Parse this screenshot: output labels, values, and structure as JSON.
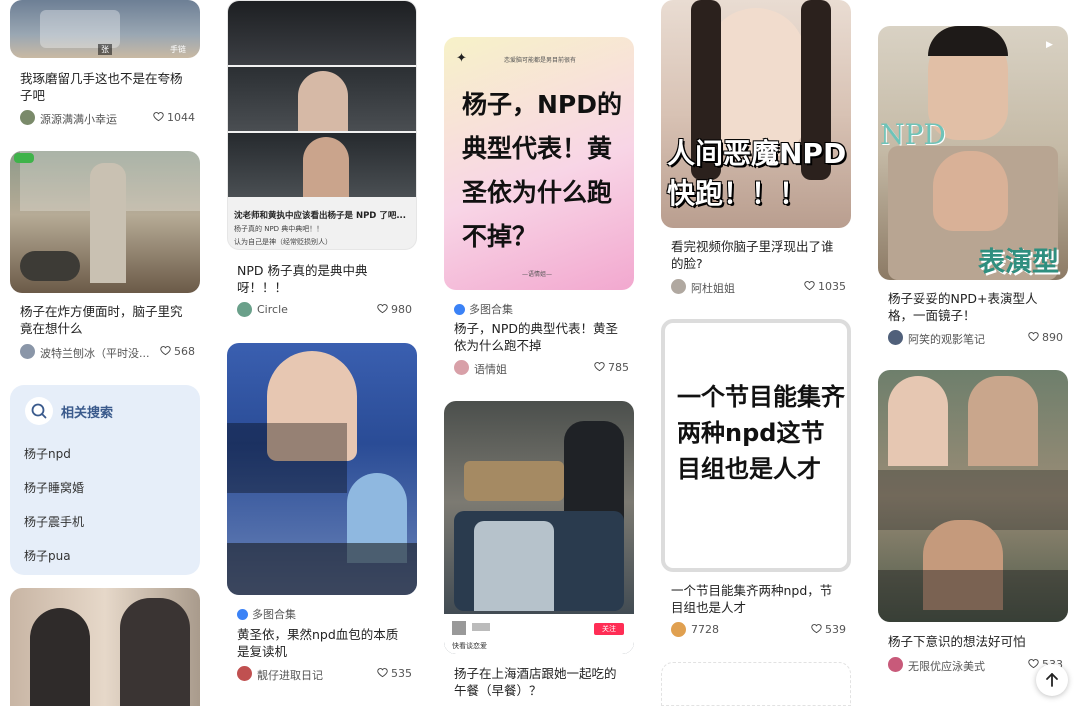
{
  "colors": {
    "accent": "#3b82f6",
    "related_bg": "#e6eef9",
    "related_title": "#3a5a8c"
  },
  "related": {
    "title": "相关搜索",
    "items": [
      "杨子npd",
      "杨子睡窝婚",
      "杨子震手机",
      "杨子pua"
    ]
  },
  "badges": {
    "multi": "多图合集"
  },
  "col1": {
    "card1": {
      "title": "我琢磨留几手这也不是在夸杨子吧",
      "author": "源源满满小幸运",
      "likes": "1044",
      "overlay": "张",
      "overlay2": "手链"
    },
    "card2": {
      "title": "杨子在炸方便面时，脑子里究竟在想什么",
      "author": "波特兰刨冰（平时没...",
      "likes": "568"
    }
  },
  "col2": {
    "card1": {
      "caption": "沈老师和黄执中应该看出杨子是 NPD 了吧...",
      "caption2": "杨子真的 NPD 典中典吧！！",
      "caption3": "认为自己是神（经常贬损别人）",
      "title": "NPD 杨子真的是典中典呀！！！",
      "author": "Circle",
      "likes": "980"
    },
    "card2": {
      "title": "黄圣依，果然npd血包的本质是复读机",
      "author": "靓仔进取日记",
      "likes": "535"
    }
  },
  "col3": {
    "card1": {
      "kicker": "恋爱脑可能都是男目前很有",
      "big": "杨子，NPD的典型代表！黄圣依为什么跑不掉？",
      "footer": "—语情姐—",
      "title": "杨子，NPD的典型代表！黄圣依为什么跑不掉",
      "author": "语情姐",
      "likes": "785"
    },
    "card2": {
      "follow": "关注",
      "strip": "快看谈恋爱",
      "title": "扬子在上海酒店跟她一起吃的午餐（早餐）？"
    }
  },
  "col4": {
    "card1": {
      "big": "人间恶魔NPD快跑！！！",
      "title": "看完视频你脑子里浮现出了谁的脸?",
      "author": "阿杜姐姐",
      "likes": "1035"
    },
    "card2": {
      "big": "一个节目能集齐两种npd这节目组也是人才",
      "title": "一个节目能集齐两种npd，节目组也是人才",
      "author": "7728",
      "likes": "539"
    }
  },
  "col5": {
    "card1": {
      "npd": "NPD",
      "show": "表演型",
      "title": "杨子妥妥的NPD+表演型人格，一面镜子！",
      "author": "阿笑的观影笔记",
      "likes": "890"
    },
    "card2": {
      "title": "杨子下意识的想法好可怕",
      "author": "无限优应泳美式",
      "likes": "533"
    }
  }
}
